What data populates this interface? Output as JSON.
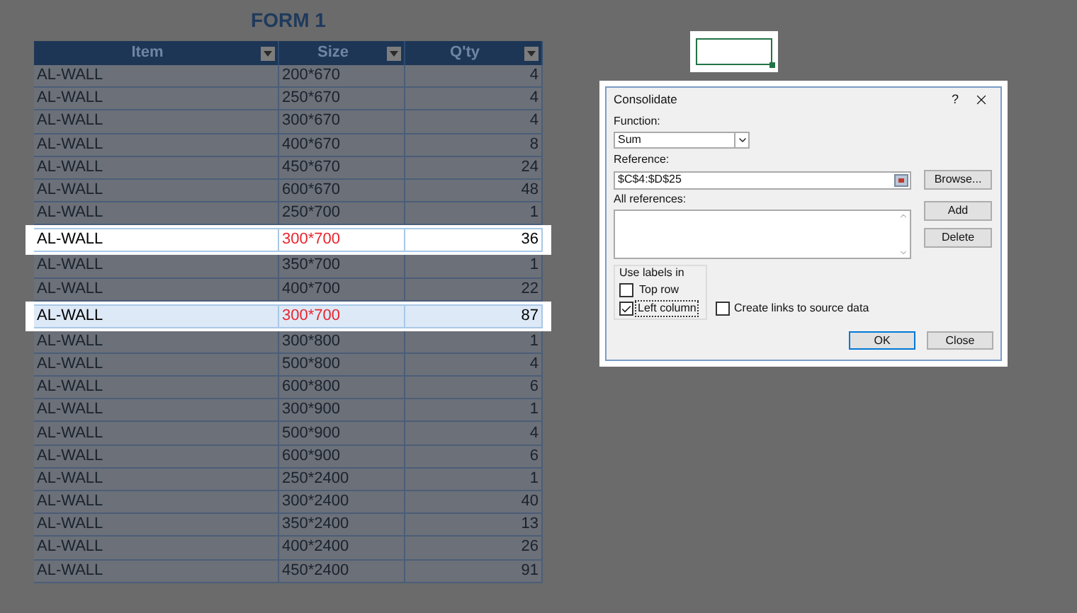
{
  "title": "FORM 1",
  "active_cell": {
    "selected": true
  },
  "table": {
    "columns": [
      {
        "label": "Item"
      },
      {
        "label": "Size"
      },
      {
        "label": "Q'ty"
      }
    ],
    "rows": [
      {
        "cells": [
          "AL-WALL",
          "200*670",
          "4"
        ],
        "highlighted": false,
        "selected": false
      },
      {
        "cells": [
          "AL-WALL",
          "250*670",
          "4"
        ],
        "highlighted": false,
        "selected": false
      },
      {
        "cells": [
          "AL-WALL",
          "300*670",
          "4"
        ],
        "highlighted": false,
        "selected": false
      },
      {
        "cells": [
          "AL-WALL",
          "400*670",
          "8"
        ],
        "highlighted": false,
        "selected": false
      },
      {
        "cells": [
          "AL-WALL",
          "450*670",
          "24"
        ],
        "highlighted": false,
        "selected": false
      },
      {
        "cells": [
          "AL-WALL",
          "600*670",
          "48"
        ],
        "highlighted": false,
        "selected": false
      },
      {
        "cells": [
          "AL-WALL",
          "250*700",
          "1"
        ],
        "highlighted": false,
        "selected": false
      },
      {
        "cells": [
          "AL-WALL",
          "300*700",
          "36"
        ],
        "highlighted": true,
        "selected": false
      },
      {
        "cells": [
          "AL-WALL",
          "350*700",
          "1"
        ],
        "highlighted": false,
        "selected": false
      },
      {
        "cells": [
          "AL-WALL",
          "400*700",
          "22"
        ],
        "highlighted": false,
        "selected": false
      },
      {
        "cells": [
          "AL-WALL",
          "300*700",
          "87"
        ],
        "highlighted": true,
        "selected": true
      },
      {
        "cells": [
          "AL-WALL",
          "300*800",
          "1"
        ],
        "highlighted": false,
        "selected": false
      },
      {
        "cells": [
          "AL-WALL",
          "500*800",
          "4"
        ],
        "highlighted": false,
        "selected": false
      },
      {
        "cells": [
          "AL-WALL",
          "600*800",
          "6"
        ],
        "highlighted": false,
        "selected": false
      },
      {
        "cells": [
          "AL-WALL",
          "300*900",
          "1"
        ],
        "highlighted": false,
        "selected": false
      },
      {
        "cells": [
          "AL-WALL",
          "500*900",
          "4"
        ],
        "highlighted": false,
        "selected": false
      },
      {
        "cells": [
          "AL-WALL",
          "600*900",
          "6"
        ],
        "highlighted": false,
        "selected": false
      },
      {
        "cells": [
          "AL-WALL",
          "250*2400",
          "1"
        ],
        "highlighted": false,
        "selected": false
      },
      {
        "cells": [
          "AL-WALL",
          "300*2400",
          "40"
        ],
        "highlighted": false,
        "selected": false
      },
      {
        "cells": [
          "AL-WALL",
          "350*2400",
          "13"
        ],
        "highlighted": false,
        "selected": false
      },
      {
        "cells": [
          "AL-WALL",
          "400*2400",
          "26"
        ],
        "highlighted": false,
        "selected": false
      },
      {
        "cells": [
          "AL-WALL",
          "450*2400",
          "91"
        ],
        "highlighted": false,
        "selected": false
      }
    ]
  },
  "dialog": {
    "title": "Consolidate",
    "help": "?",
    "function": {
      "label": "Function:",
      "value": "Sum"
    },
    "reference": {
      "label": "Reference:",
      "value": "$C$4:$D$25"
    },
    "browse": "Browse...",
    "all_references": {
      "label": "All references:"
    },
    "add": "Add",
    "delete": "Delete",
    "labels_group": {
      "title": "Use labels in",
      "options": [
        {
          "label": "Top row",
          "checked": false,
          "focused": false
        },
        {
          "label": "Left column",
          "checked": true,
          "focused": true
        }
      ]
    },
    "links": {
      "label": "Create links to source data",
      "checked": false
    },
    "ok": "OK",
    "close": "Close"
  }
}
